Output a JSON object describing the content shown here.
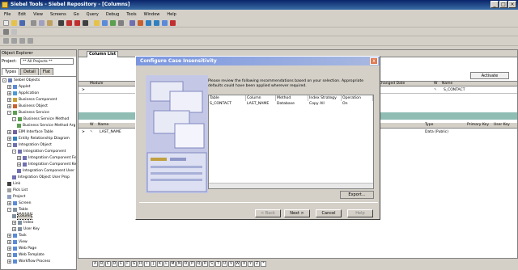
{
  "window": {
    "title": "Siebel Tools - Siebel Repository - [Columns]"
  },
  "menu": [
    "File",
    "Edit",
    "View",
    "Screens",
    "Go",
    "Query",
    "Debug",
    "Tools",
    "Window",
    "Help"
  ],
  "explorer": {
    "title": "Object Explorer",
    "project_label": "Project:",
    "project_value": "** All Projects **",
    "tabs": [
      "Types",
      "Detail",
      "Flat"
    ],
    "tree": [
      {
        "label": "Siebel Objects",
        "level": 0,
        "exp": "-",
        "icon": "#6a7fb8"
      },
      {
        "label": "Applet",
        "level": 1,
        "exp": "+",
        "icon": "#5a8ad8"
      },
      {
        "label": "Application",
        "level": 1,
        "exp": "+",
        "icon": "#4a9ad8"
      },
      {
        "label": "Business Component",
        "level": 1,
        "exp": "+",
        "icon": "#c8a030"
      },
      {
        "label": "Business Object",
        "level": 1,
        "exp": "+",
        "icon": "#c86030"
      },
      {
        "label": "Business Service",
        "level": 1,
        "exp": "-",
        "icon": "#5aa050"
      },
      {
        "label": "Business Service Method",
        "level": 2,
        "exp": "-",
        "icon": "#5aa050"
      },
      {
        "label": "Business Service Method Arg",
        "level": 3,
        "exp": "",
        "icon": "#5aa050"
      },
      {
        "label": "EIM Interface Table",
        "level": 1,
        "exp": "+",
        "icon": "#7060a0"
      },
      {
        "label": "Entity Relationship Diagram",
        "level": 1,
        "exp": "+",
        "icon": "#3080c0"
      },
      {
        "label": "Integration Object",
        "level": 1,
        "exp": "-",
        "icon": "#7070b0"
      },
      {
        "label": "Integration Component",
        "level": 2,
        "exp": "-",
        "icon": "#7070b0"
      },
      {
        "label": "Integration Component Field",
        "level": 3,
        "exp": "+",
        "icon": "#7070b0"
      },
      {
        "label": "Integration Component Key",
        "level": 3,
        "exp": "+",
        "icon": "#7070b0"
      },
      {
        "label": "Integration Component User Prop",
        "level": 3,
        "exp": "",
        "icon": "#7070b0"
      },
      {
        "label": "Integration Object User Prop",
        "level": 2,
        "exp": "",
        "icon": "#7070b0"
      },
      {
        "label": "Link",
        "level": 1,
        "exp": "",
        "icon": "#404040"
      },
      {
        "label": "Pick List",
        "level": 1,
        "exp": "",
        "icon": "#a0a0a0"
      },
      {
        "label": "Project",
        "level": 1,
        "exp": "",
        "icon": "#90a0c0"
      },
      {
        "label": "Screen",
        "level": 1,
        "exp": "+",
        "icon": "#5a8ad8"
      },
      {
        "label": "Table",
        "level": 1,
        "exp": "-",
        "icon": "#8090a0"
      },
      {
        "label": "Column",
        "level": 2,
        "exp": "",
        "icon": "#8090a0",
        "selected": true
      },
      {
        "label": "Index",
        "level": 2,
        "exp": "+",
        "icon": "#8090a0"
      },
      {
        "label": "User Key",
        "level": 2,
        "exp": "+",
        "icon": "#8090a0"
      },
      {
        "label": "Task",
        "level": 1,
        "exp": "+",
        "icon": "#5a8ad8"
      },
      {
        "label": "View",
        "level": 1,
        "exp": "+",
        "icon": "#5a8ad8"
      },
      {
        "label": "Web Page",
        "level": 1,
        "exp": "+",
        "icon": "#5a8ad8"
      },
      {
        "label": "Web Template",
        "level": 1,
        "exp": "+",
        "icon": "#5a8ad8"
      },
      {
        "label": "Workflow Process",
        "level": 1,
        "exp": "+",
        "icon": "#5a8ad8"
      }
    ]
  },
  "panel": {
    "tab": "Column List",
    "activate_label": "Activate",
    "grid1_headers": {
      "module": "Module",
      "changed_date": "Changed Date",
      "w": "W",
      "name": "Name"
    },
    "grid1_row": {
      "name": "S_CONTACT"
    },
    "grid2_headers": {
      "w": "W",
      "name": "Name",
      "type": "Type",
      "primary_key": "Primary Key",
      "user_key": "User Key"
    },
    "grid2_row": {
      "name": "LAST_NAME",
      "type": "Data (Public)"
    },
    "alphabet": [
      "A",
      "B",
      "C",
      "D",
      "E",
      "F",
      "G",
      "H",
      "I",
      "J",
      "K",
      "L",
      "M",
      "N",
      "O",
      "P",
      "Q",
      "R",
      "S",
      "T",
      "U",
      "V",
      "W",
      "X",
      "Y",
      "Z",
      "*"
    ]
  },
  "dialog": {
    "title": "Configure Case Insensitivity",
    "close": "x",
    "message": "Please review the following recommendations based on your selection. Appropriate defaults could have been applied wherever required.",
    "columns": [
      "Table",
      "Column",
      "Method",
      "Index Strategy",
      "Operation"
    ],
    "rows": [
      [
        "S_CONTACT",
        "LAST_NAME",
        "Database",
        "Copy All",
        "On"
      ]
    ],
    "export_label": "Export...",
    "buttons": {
      "back": "< Back",
      "next": "Next >",
      "cancel": "Cancel",
      "help": "Help"
    }
  },
  "colors": {
    "titlebar": "#0a246a",
    "dialog_title": "#7a96df",
    "teal_bar": "#8fbdb4",
    "chrome": "#d4d0c8"
  }
}
